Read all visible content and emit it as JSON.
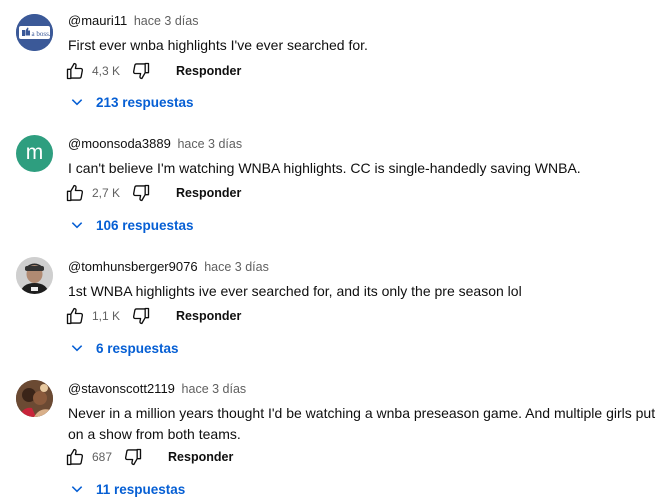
{
  "reply_label": "Responder",
  "comments": [
    {
      "author": "@mauri11",
      "time": "hace 3 días",
      "text": "First ever wnba highlights I've ever searched for.",
      "likes": "4,3 K",
      "replies": "213 respuestas",
      "avatar_text": "a boss."
    },
    {
      "author": "@moonsoda3889",
      "time": "hace 3 días",
      "text": "I can't believe I'm watching WNBA highlights. CC is single-handedly saving WNBA.",
      "likes": "2,7 K",
      "replies": "106 respuestas",
      "avatar_text": "m"
    },
    {
      "author": "@tomhunsberger9076",
      "time": "hace 3 días",
      "text": "1st WNBA highlights ive ever searched for, and its only the pre season lol",
      "likes": "1,1 K",
      "replies": "6 respuestas"
    },
    {
      "author": "@stavonscott2119",
      "time": "hace 3 días",
      "text": "Never in a million years thought I'd be watching a wnba preseason game. And multiple girls put on a show from both teams.",
      "likes": "687",
      "replies": "11 respuestas"
    }
  ],
  "colors": {
    "link": "#065fd4",
    "avatar_m": "#2e9e7f",
    "avatar_boss": "#3b5998"
  }
}
